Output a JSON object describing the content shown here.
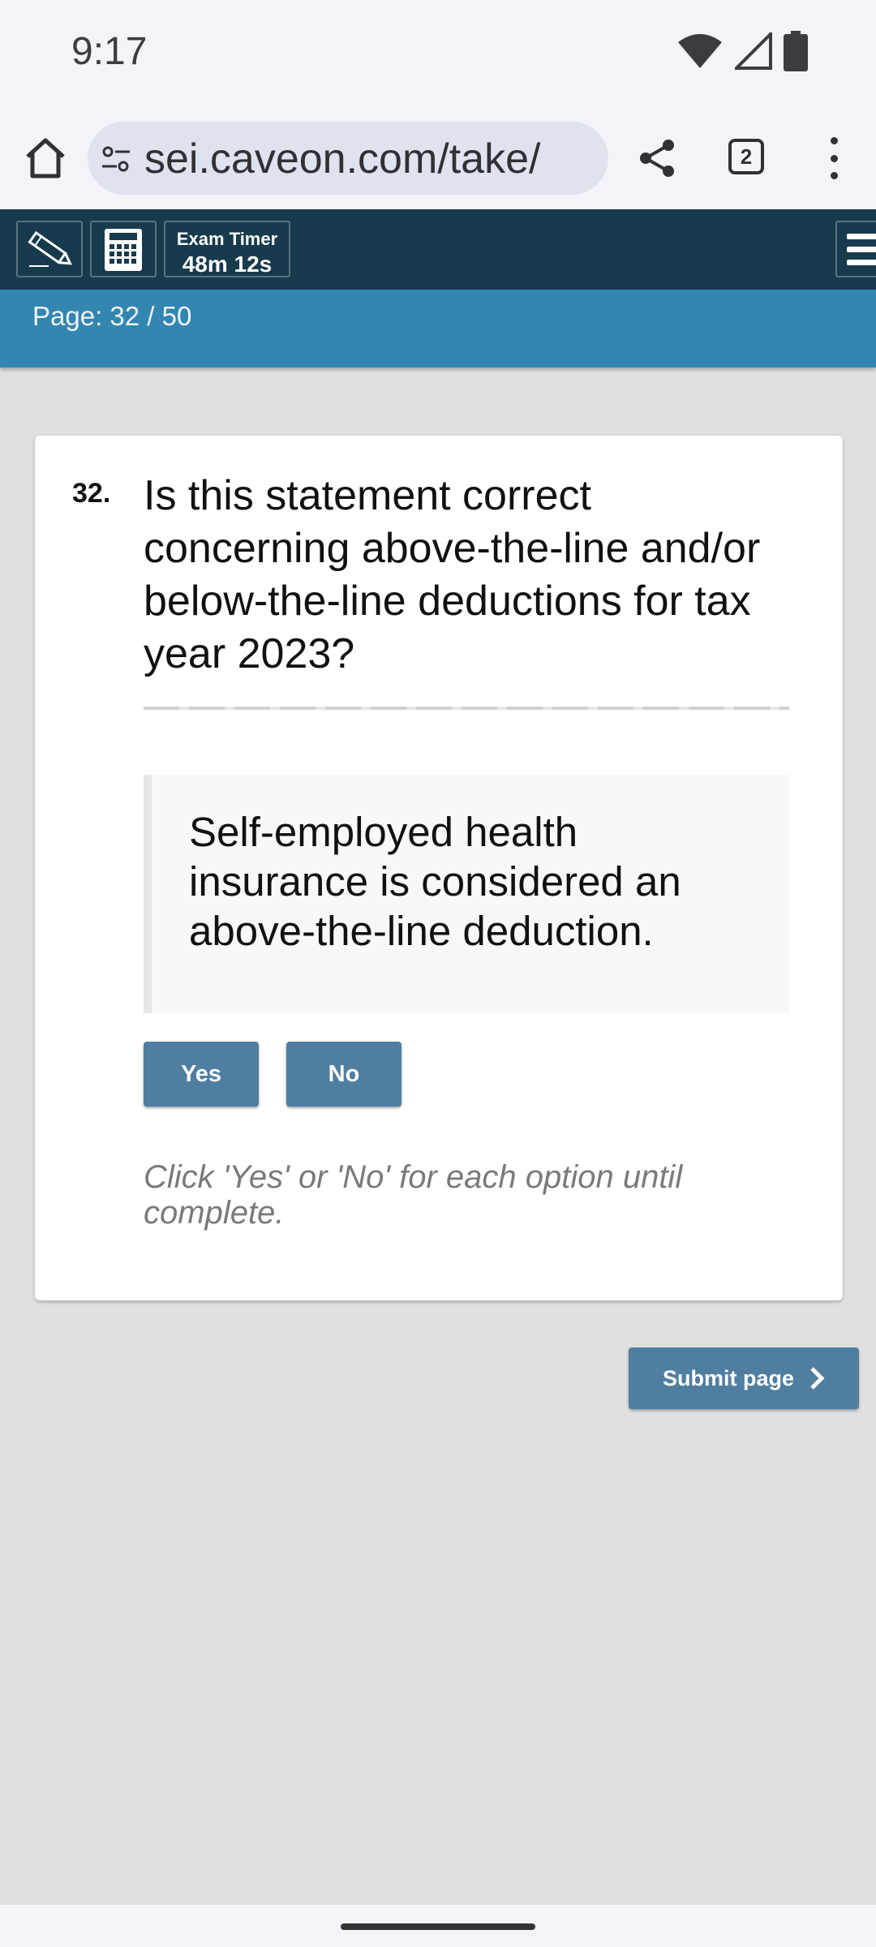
{
  "status_bar": {
    "time": "9:17",
    "icons": [
      "wifi-icon",
      "signal-icon",
      "battery-icon"
    ]
  },
  "browser": {
    "url": "sei.caveon.com/take/",
    "tab_count": "2",
    "icons": [
      "home-icon",
      "tune-icon",
      "share-icon",
      "tabs-icon",
      "more-vert-icon"
    ]
  },
  "exam_toolbar": {
    "tools": [
      "pencil-icon",
      "calculator-icon"
    ],
    "timer_label": "Exam Timer",
    "timer_value": "48m 12s",
    "menu_icon": "hamburger-icon",
    "background": "#173a4c"
  },
  "page_indicator": {
    "text": "Page: 32 / 50",
    "background": "#3386b1"
  },
  "question": {
    "number": "32.",
    "text": "Is this statement correct concerning above-the-line and/or below-the-line deductions for tax year 2023?",
    "statement": "Self-employed health insurance is considered an above-the-line deduction.",
    "options": [
      {
        "label": "Yes"
      },
      {
        "label": "No"
      }
    ],
    "hint": "Click 'Yes' or 'No' for each option until complete."
  },
  "submit": {
    "label": "Submit page",
    "icon": "chevron-right-icon"
  },
  "colors": {
    "button": "#4f7ea0",
    "page_bg": "#e0e0e0"
  }
}
